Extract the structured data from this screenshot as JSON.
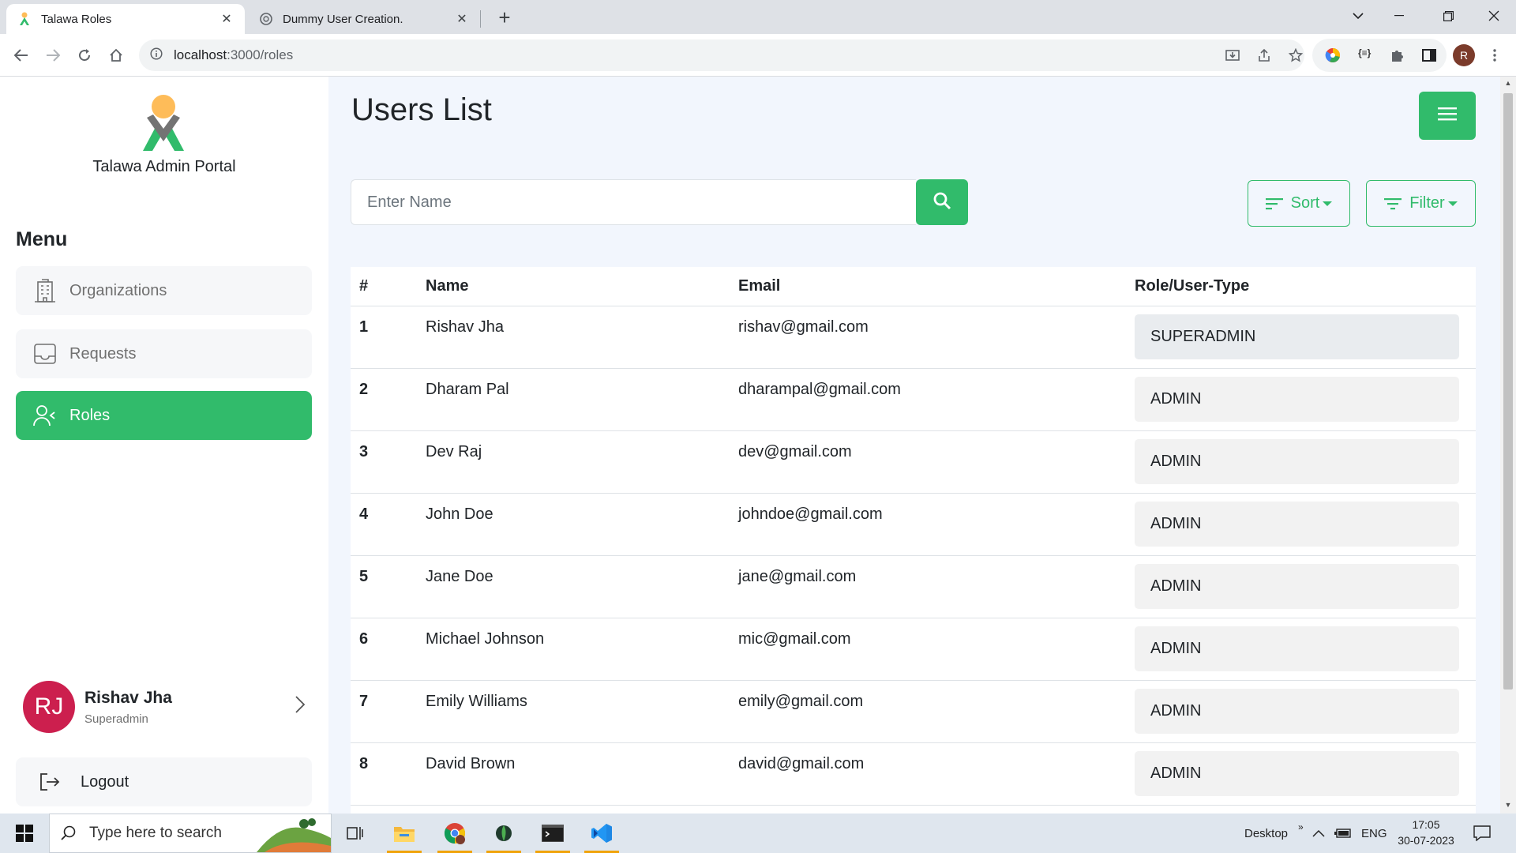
{
  "browser": {
    "tabs": [
      {
        "title": "Talawa Roles",
        "active": true
      },
      {
        "title": "Dummy User Creation.",
        "active": false
      }
    ],
    "url_host": "localhost",
    "url_path": ":3000/roles",
    "profile_initial": "R"
  },
  "sidebar": {
    "portal_name": "Talawa Admin Portal",
    "menu_title": "Menu",
    "items": [
      {
        "label": "Organizations",
        "icon": "building-icon",
        "active": false
      },
      {
        "label": "Requests",
        "icon": "inbox-icon",
        "active": false
      },
      {
        "label": "Roles",
        "icon": "user-roles-icon",
        "active": true
      }
    ],
    "user": {
      "initials": "RJ",
      "name": "Rishav Jha",
      "role": "Superadmin"
    },
    "logout_label": "Logout"
  },
  "main": {
    "title": "Users List",
    "search_placeholder": "Enter Name",
    "sort_label": "Sort",
    "filter_label": "Filter",
    "table": {
      "headers": [
        "#",
        "Name",
        "Email",
        "Role/User-Type"
      ],
      "rows": [
        {
          "index": "1",
          "name": "Rishav Jha",
          "email": "rishav@gmail.com",
          "role": "SUPERADMIN"
        },
        {
          "index": "2",
          "name": "Dharam Pal",
          "email": "dharampal@gmail.com",
          "role": "ADMIN"
        },
        {
          "index": "3",
          "name": "Dev Raj",
          "email": "dev@gmail.com",
          "role": "ADMIN"
        },
        {
          "index": "4",
          "name": "John Doe",
          "email": "johndoe@gmail.com",
          "role": "ADMIN"
        },
        {
          "index": "5",
          "name": "Jane Doe",
          "email": "jane@gmail.com",
          "role": "ADMIN"
        },
        {
          "index": "6",
          "name": "Michael Johnson",
          "email": "mic@gmail.com",
          "role": "ADMIN"
        },
        {
          "index": "7",
          "name": "Emily Williams",
          "email": "emily@gmail.com",
          "role": "ADMIN"
        },
        {
          "index": "8",
          "name": "David Brown",
          "email": "david@gmail.com",
          "role": "ADMIN"
        }
      ]
    }
  },
  "taskbar": {
    "search_placeholder": "Type here to search",
    "desktop_label": "Desktop",
    "language": "ENG",
    "time": "17:05",
    "date": "30-07-2023"
  },
  "colors": {
    "accent": "#31bb6b",
    "avatar": "#cc1f4e"
  }
}
